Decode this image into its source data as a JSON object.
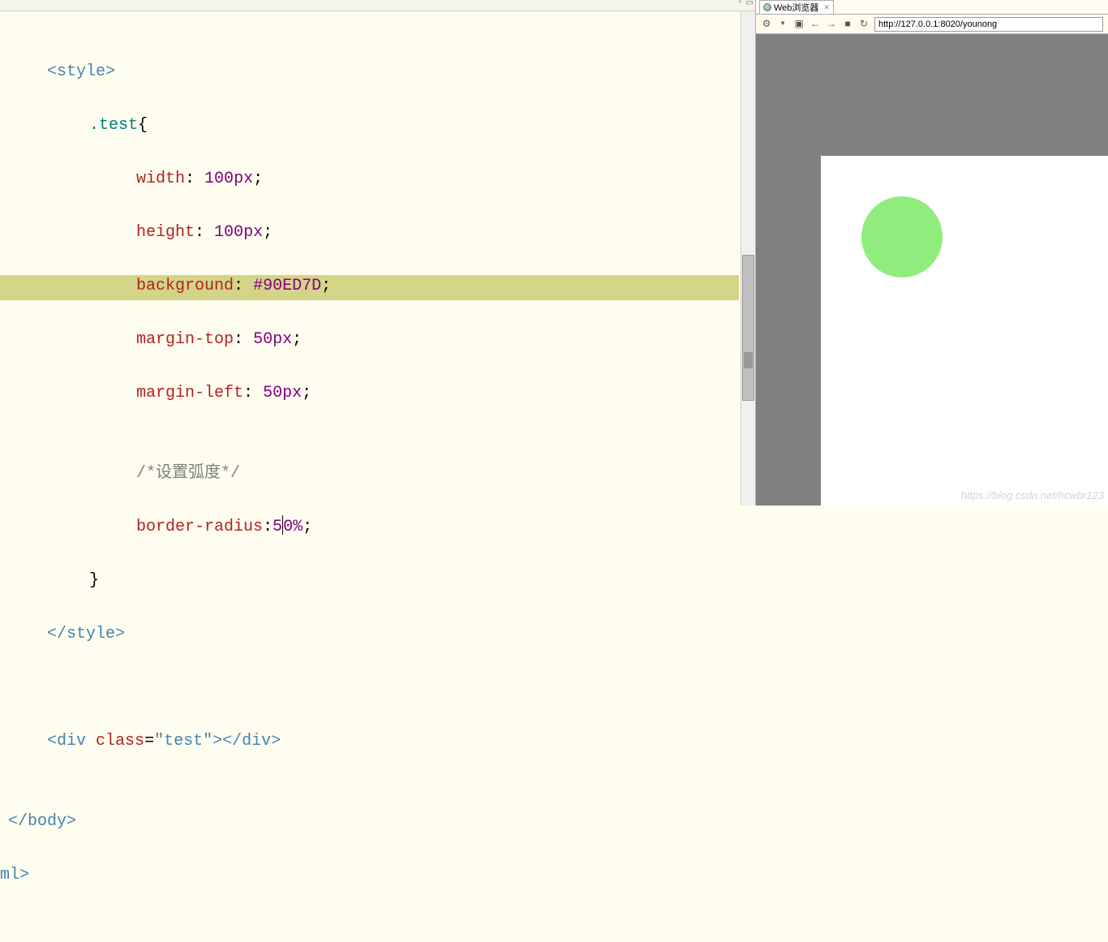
{
  "editor": {
    "lines": {
      "style_open_lt": "<",
      "style_open_tag": "style",
      "style_open_gt": ">",
      "selector": ".test",
      "brace_open": "{",
      "width_prop": "width",
      "width_val": "100",
      "width_unit": "px",
      "height_prop": "height",
      "height_val": "100",
      "height_unit": "px",
      "bg_prop": "background",
      "bg_val": "#90ED7D",
      "mt_prop": "margin-top",
      "mt_val": "50",
      "mt_unit": "px",
      "ml_prop": "margin-left",
      "ml_val": "50",
      "ml_unit": "px",
      "comment": "/*设置弧度*/",
      "br_prop": "border-radius",
      "br_val_a": "5",
      "br_val_b": "0",
      "br_unit": "%",
      "brace_close": "}",
      "style_close_lt": "</",
      "style_close_tag": "style",
      "style_close_gt": ">",
      "div_lt": "<",
      "div_tag": "div",
      "div_attr": "class",
      "div_eq": "=",
      "div_q1": "\"",
      "div_val": "test",
      "div_q2": "\"",
      "div_gt": ">",
      "div_close_lt": "</",
      "div_close_tag": "div",
      "div_close_gt": ">",
      "body_lt": "</",
      "body_tag": "body",
      "body_gt": ">",
      "ml_tag": "ml",
      "ml_gt": ">"
    },
    "colon": ":",
    "semi": ";",
    "space": " "
  },
  "browser": {
    "tab_title": "Web浏览器",
    "url": "http://127.0.0.1:8020/younong"
  },
  "watermark": "https://blog.csdn.net/hcwbr123",
  "preview": {
    "circle_color": "#90ED7D"
  }
}
